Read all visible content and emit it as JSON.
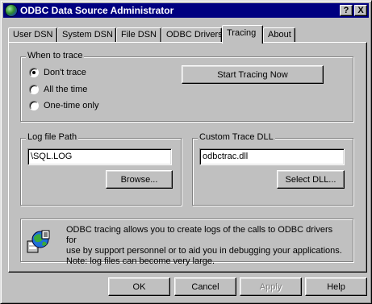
{
  "window": {
    "title": "ODBC Data Source Administrator",
    "help_button": "?",
    "close_button": "X"
  },
  "tabs": [
    {
      "label": "User DSN"
    },
    {
      "label": "System DSN"
    },
    {
      "label": "File DSN"
    },
    {
      "label": "ODBC Drivers"
    },
    {
      "label": "Tracing",
      "active": true
    },
    {
      "label": "About"
    }
  ],
  "when_to_trace": {
    "label": "When to trace",
    "options": [
      {
        "label": "Don't trace",
        "checked": true
      },
      {
        "label": "All the time",
        "checked": false
      },
      {
        "label": "One-time only",
        "checked": false
      }
    ],
    "start_button": "Start Tracing Now"
  },
  "log_file": {
    "label": "Log file Path",
    "value": "\\SQL.LOG",
    "browse_button": "Browse..."
  },
  "trace_dll": {
    "label": "Custom Trace DLL",
    "value": "odbctrac.dll",
    "select_button": "Select DLL..."
  },
  "info": {
    "icon": "odbc-globe-icon",
    "lines": [
      "ODBC tracing allows you to create logs of the calls to ODBC drivers for",
      "use by support personnel or to aid you in debugging your applications.",
      "Note: log files can become very large."
    ]
  },
  "footer": {
    "ok": "OK",
    "cancel": "Cancel",
    "apply": "Apply",
    "help": "Help"
  }
}
